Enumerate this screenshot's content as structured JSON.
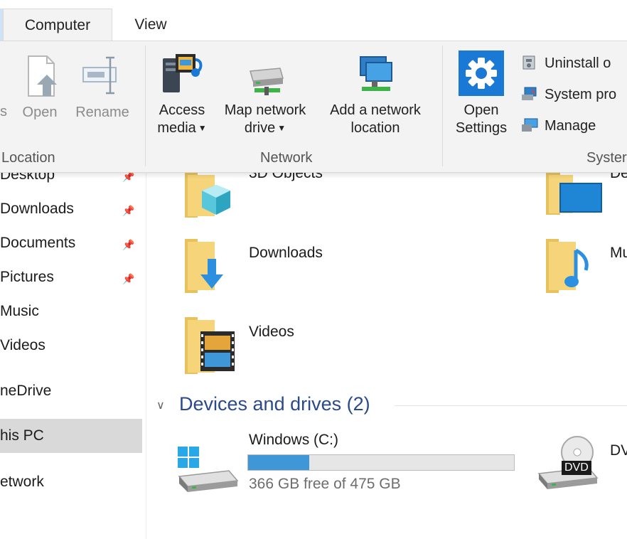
{
  "tabs": {
    "computer": "Computer",
    "view": "View"
  },
  "ribbon": {
    "location": {
      "group_label": "Location",
      "cut_label": "s",
      "open_label": "Open",
      "rename_label": "Rename"
    },
    "network": {
      "group_label": "Network",
      "access_media": [
        "Access",
        "media"
      ],
      "map_network_drive": [
        "Map network",
        "drive"
      ],
      "add_network_location": [
        "Add a network",
        "location"
      ]
    },
    "system": {
      "group_label": "Syster",
      "open_settings": [
        "Open",
        "Settings"
      ],
      "uninstall": "Uninstall o",
      "system_properties": "System pro",
      "manage": "Manage"
    }
  },
  "nav": {
    "items": [
      {
        "label": "Desktop",
        "pinned": true
      },
      {
        "label": "Downloads",
        "pinned": true
      },
      {
        "label": "Documents",
        "pinned": true
      },
      {
        "label": "Pictures",
        "pinned": true
      },
      {
        "label": "Music",
        "pinned": false
      },
      {
        "label": "Videos",
        "pinned": false
      },
      {
        "label": "neDrive",
        "pinned": false
      },
      {
        "label": "his PC",
        "pinned": false
      },
      {
        "label": "etwork",
        "pinned": false
      }
    ],
    "pin_glyph": "📌"
  },
  "folders": {
    "objects3d": "3D Objects",
    "desktop": "De",
    "downloads": "Downloads",
    "music": "Mu",
    "videos": "Videos"
  },
  "devices": {
    "title": "Devices and drives (2)",
    "drive_c": {
      "name": "Windows (C:)",
      "free": "366 GB free of 475 GB",
      "used_fraction": 0.23
    },
    "dvd": {
      "name": "DV",
      "badge": "DVD"
    }
  },
  "colors": {
    "accent": "#3f97d8",
    "folder": "#f6d57a",
    "section": "#2a4a8c",
    "settings_blue": "#1a79d4"
  }
}
